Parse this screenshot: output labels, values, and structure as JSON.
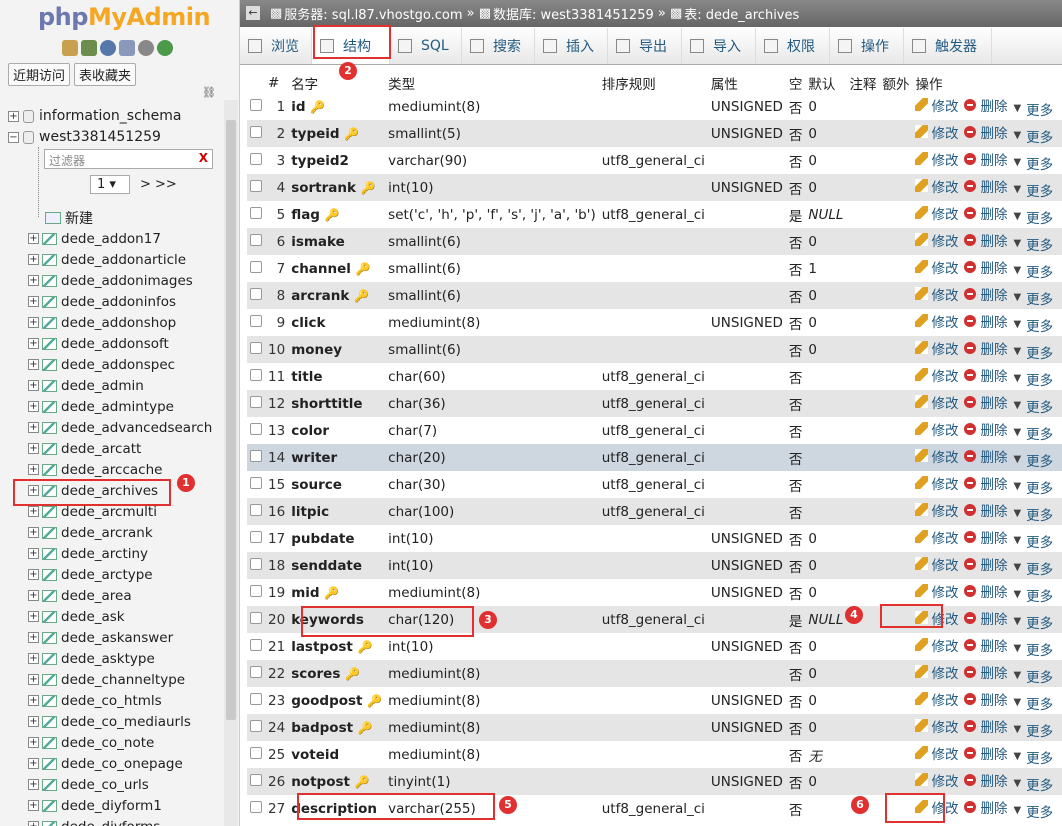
{
  "sidebar": {
    "logo_php": "php",
    "logo_my": "MyAdmin",
    "nav_tabs": [
      "近期访问",
      "表收藏夹"
    ],
    "databases": [
      "information_schema",
      "west3381451259"
    ],
    "filter_placeholder": "过滤器",
    "filter_clear": "X",
    "page_value": "1",
    "page_next": "> >>",
    "new_label": "新建",
    "tables": [
      "dede_addon17",
      "dede_addonarticle",
      "dede_addonimages",
      "dede_addoninfos",
      "dede_addonshop",
      "dede_addonsoft",
      "dede_addonspec",
      "dede_admin",
      "dede_admintype",
      "dede_advancedsearch",
      "dede_arcatt",
      "dede_arccache",
      "dede_archives",
      "dede_arcmulti",
      "dede_arcrank",
      "dede_arctiny",
      "dede_arctype",
      "dede_area",
      "dede_ask",
      "dede_askanswer",
      "dede_asktype",
      "dede_channeltype",
      "dede_co_htmls",
      "dede_co_mediaurls",
      "dede_co_note",
      "dede_co_onepage",
      "dede_co_urls",
      "dede_diyform1",
      "dede_diyforms"
    ]
  },
  "breadcrumb": {
    "server": "服务器: sql.l87.vhostgo.com",
    "database": "数据库: west3381451259",
    "table": "表: dede_archives"
  },
  "tabs": [
    "浏览",
    "结构",
    "SQL",
    "搜索",
    "插入",
    "导出",
    "导入",
    "权限",
    "操作",
    "触发器"
  ],
  "columns": [
    "#",
    "名字",
    "类型",
    "排序规则",
    "属性",
    "空",
    "默认",
    "注释",
    "额外",
    "操作"
  ],
  "actions": {
    "edit": "修改",
    "drop": "删除",
    "more": "更多"
  },
  "rows": [
    {
      "n": "1",
      "name": "id",
      "type": "mediumint(8)",
      "coll": "",
      "attr": "UNSIGNED",
      "null": "否",
      "def": "0",
      "key": "primary"
    },
    {
      "n": "2",
      "name": "typeid",
      "type": "smallint(5)",
      "coll": "",
      "attr": "UNSIGNED",
      "null": "否",
      "def": "0",
      "key": "index"
    },
    {
      "n": "3",
      "name": "typeid2",
      "type": "varchar(90)",
      "coll": "utf8_general_ci",
      "attr": "",
      "null": "否",
      "def": "0",
      "key": ""
    },
    {
      "n": "4",
      "name": "sortrank",
      "type": "int(10)",
      "coll": "",
      "attr": "UNSIGNED",
      "null": "否",
      "def": "0",
      "key": "index"
    },
    {
      "n": "5",
      "name": "flag",
      "type": "set('c', 'h', 'p', 'f', 's', 'j', 'a', 'b')",
      "coll": "utf8_general_ci",
      "attr": "",
      "null": "是",
      "def": "NULL",
      "key": "index"
    },
    {
      "n": "6",
      "name": "ismake",
      "type": "smallint(6)",
      "coll": "",
      "attr": "",
      "null": "否",
      "def": "0",
      "key": ""
    },
    {
      "n": "7",
      "name": "channel",
      "type": "smallint(6)",
      "coll": "",
      "attr": "",
      "null": "否",
      "def": "1",
      "key": "index"
    },
    {
      "n": "8",
      "name": "arcrank",
      "type": "smallint(6)",
      "coll": "",
      "attr": "",
      "null": "否",
      "def": "0",
      "key": "index"
    },
    {
      "n": "9",
      "name": "click",
      "type": "mediumint(8)",
      "coll": "",
      "attr": "UNSIGNED",
      "null": "否",
      "def": "0",
      "key": ""
    },
    {
      "n": "10",
      "name": "money",
      "type": "smallint(6)",
      "coll": "",
      "attr": "",
      "null": "否",
      "def": "0",
      "key": ""
    },
    {
      "n": "11",
      "name": "title",
      "type": "char(60)",
      "coll": "utf8_general_ci",
      "attr": "",
      "null": "否",
      "def": "",
      "key": ""
    },
    {
      "n": "12",
      "name": "shorttitle",
      "type": "char(36)",
      "coll": "utf8_general_ci",
      "attr": "",
      "null": "否",
      "def": "",
      "key": ""
    },
    {
      "n": "13",
      "name": "color",
      "type": "char(7)",
      "coll": "utf8_general_ci",
      "attr": "",
      "null": "否",
      "def": "",
      "key": ""
    },
    {
      "n": "14",
      "name": "writer",
      "type": "char(20)",
      "coll": "utf8_general_ci",
      "attr": "",
      "null": "否",
      "def": "",
      "key": ""
    },
    {
      "n": "15",
      "name": "source",
      "type": "char(30)",
      "coll": "utf8_general_ci",
      "attr": "",
      "null": "否",
      "def": "",
      "key": ""
    },
    {
      "n": "16",
      "name": "litpic",
      "type": "char(100)",
      "coll": "utf8_general_ci",
      "attr": "",
      "null": "否",
      "def": "",
      "key": ""
    },
    {
      "n": "17",
      "name": "pubdate",
      "type": "int(10)",
      "coll": "",
      "attr": "UNSIGNED",
      "null": "否",
      "def": "0",
      "key": ""
    },
    {
      "n": "18",
      "name": "senddate",
      "type": "int(10)",
      "coll": "",
      "attr": "UNSIGNED",
      "null": "否",
      "def": "0",
      "key": ""
    },
    {
      "n": "19",
      "name": "mid",
      "type": "mediumint(8)",
      "coll": "",
      "attr": "UNSIGNED",
      "null": "否",
      "def": "0",
      "key": "index"
    },
    {
      "n": "20",
      "name": "keywords",
      "type": "char(120)",
      "coll": "utf8_general_ci",
      "attr": "",
      "null": "是",
      "def": "NULL",
      "key": ""
    },
    {
      "n": "21",
      "name": "lastpost",
      "type": "int(10)",
      "coll": "",
      "attr": "UNSIGNED",
      "null": "否",
      "def": "0",
      "key": "index"
    },
    {
      "n": "22",
      "name": "scores",
      "type": "mediumint(8)",
      "coll": "",
      "attr": "",
      "null": "否",
      "def": "0",
      "key": "index"
    },
    {
      "n": "23",
      "name": "goodpost",
      "type": "mediumint(8)",
      "coll": "",
      "attr": "UNSIGNED",
      "null": "否",
      "def": "0",
      "key": "index"
    },
    {
      "n": "24",
      "name": "badpost",
      "type": "mediumint(8)",
      "coll": "",
      "attr": "UNSIGNED",
      "null": "否",
      "def": "0",
      "key": "index"
    },
    {
      "n": "25",
      "name": "voteid",
      "type": "mediumint(8)",
      "coll": "",
      "attr": "",
      "null": "否",
      "def": "无",
      "key": ""
    },
    {
      "n": "26",
      "name": "notpost",
      "type": "tinyint(1)",
      "coll": "",
      "attr": "UNSIGNED",
      "null": "否",
      "def": "0",
      "key": "index"
    },
    {
      "n": "27",
      "name": "description",
      "type": "varchar(255)",
      "coll": "utf8_general_ci",
      "attr": "",
      "null": "否",
      "def": "",
      "key": ""
    }
  ],
  "badges": [
    "1",
    "2",
    "3",
    "4",
    "5",
    "6"
  ],
  "colors": {
    "accent": "#e03030",
    "link": "#235a81",
    "header": "#666666",
    "highlight_row": "#ced6df"
  }
}
